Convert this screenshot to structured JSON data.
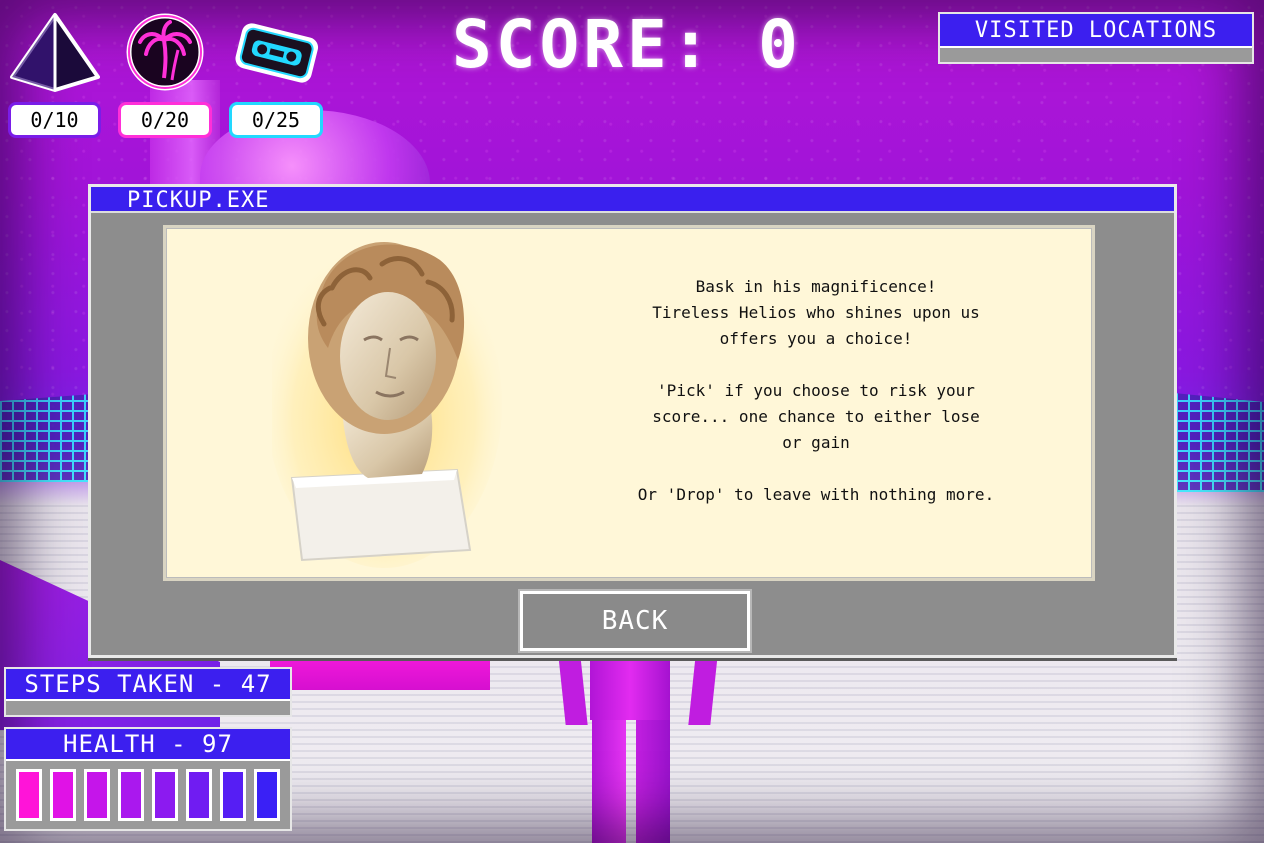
{
  "hud": {
    "collectibles": [
      {
        "icon": "pyramid-icon",
        "count": "0/10",
        "border_color": "#7a1de8"
      },
      {
        "icon": "palm-tree-icon",
        "count": "0/20",
        "border_color": "#ff2fd8"
      },
      {
        "icon": "cassette-icon",
        "count": "0/25",
        "border_color": "#22d8ff"
      }
    ],
    "score_label": "SCORE: 0",
    "visited_locations_label": "VISITED LOCATIONS",
    "steps_label": "STEPS TAKEN - 47",
    "health_label": "HEALTH - 97",
    "health": {
      "value": 97,
      "cells": 8,
      "cell_colors": [
        "#ff14d8",
        "#e012e6",
        "#c515ea",
        "#aa18ee",
        "#8c1af0",
        "#701cf2",
        "#561ef4",
        "#3a20f6"
      ]
    }
  },
  "dialog": {
    "title": "PICKUP.EXE",
    "image": "helios-bust",
    "message": {
      "p1": [
        "Bask in his magnificence!",
        "Tireless Helios who shines upon us",
        "offers you a choice!"
      ],
      "p2": [
        "'Pick' if you choose to risk your",
        "score... one chance to either lose",
        "or gain"
      ],
      "p3": [
        "Or 'Drop' to leave with nothing more."
      ]
    },
    "back_label": "BACK"
  },
  "colors": {
    "accent_blue": "#3a20ee",
    "panel_gray": "#8d8d8d",
    "content_cream": "#fff7d8"
  }
}
